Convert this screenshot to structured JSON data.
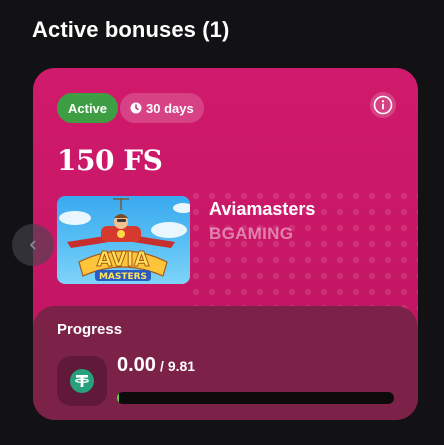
{
  "header": {
    "title": "Active bonuses (1)"
  },
  "card": {
    "status_badge": "Active",
    "duration_badge": "30 days",
    "amount": "150 FS",
    "game": {
      "name": "Aviamasters",
      "provider": "BGAMING",
      "thumbnail_text_top": "AVIA",
      "thumbnail_text_bottom": "MASTERS"
    },
    "progress": {
      "title": "Progress",
      "current": "0.00",
      "separator": "/",
      "target": "9.81",
      "fraction": 0.0,
      "currency_icon": "tether-icon"
    }
  },
  "icons": {
    "prev": "chevron-left-icon",
    "clock": "clock-icon",
    "info": "info-icon"
  },
  "colors": {
    "card_primary": "#d01a6c",
    "active_badge": "#3e9e43",
    "progress_fill": "#61d255",
    "tether": "#26a17b"
  }
}
